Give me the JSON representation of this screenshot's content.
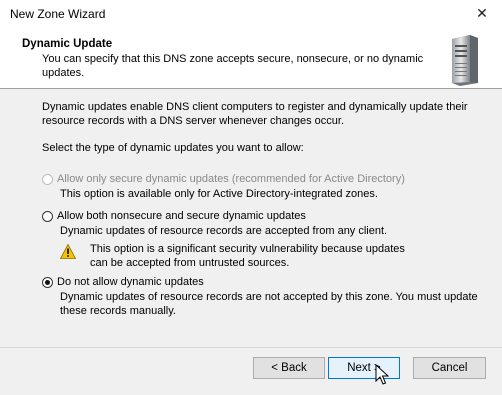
{
  "window": {
    "title": "New Zone Wizard",
    "close_glyph": "✕"
  },
  "header": {
    "title": "Dynamic Update",
    "description": "You can specify that this DNS zone accepts secure, nonsecure, or no dynamic updates.",
    "icon": "server-icon"
  },
  "intro": {
    "paragraph": "Dynamic updates enable DNS client computers to register and dynamically update their resource records with a DNS server whenever changes occur.",
    "prompt": "Select the type of dynamic updates you want to allow:"
  },
  "options": [
    {
      "label": "Allow only secure dynamic updates (recommended for Active Directory)",
      "description": "This option is available only for Active Directory-integrated zones.",
      "enabled": false,
      "selected": false
    },
    {
      "label": "Allow both nonsecure and secure dynamic updates",
      "description": "Dynamic updates of resource records are accepted from any client.",
      "warning": "This option is a significant security vulnerability because updates can be accepted from untrusted sources.",
      "enabled": true,
      "selected": false
    },
    {
      "label": "Do not allow dynamic updates",
      "description": "Dynamic updates of resource records are not accepted by this zone. You must update these records manually.",
      "enabled": true,
      "selected": true
    }
  ],
  "buttons": {
    "back": "< Back",
    "next": "Next >",
    "cancel": "Cancel"
  },
  "colors": {
    "accent": "#0078d7",
    "warning": "#f5c400"
  }
}
